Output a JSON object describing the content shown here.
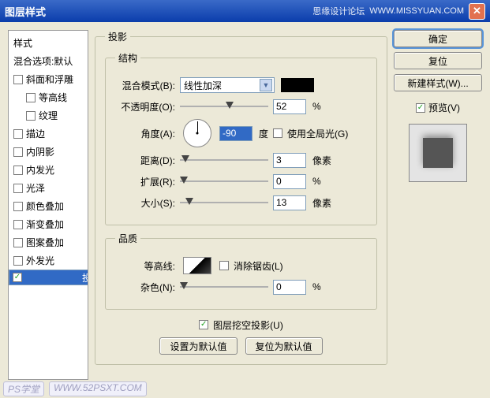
{
  "title": "图层样式",
  "watermark1": "思缘设计论坛",
  "watermark2": "WWW.MISSYUAN.COM",
  "sidebar": {
    "header": "样式",
    "blend": "混合选项:默认",
    "items": [
      {
        "label": "斜面和浮雕",
        "checked": false,
        "indent": false
      },
      {
        "label": "等高线",
        "checked": false,
        "indent": true
      },
      {
        "label": "纹理",
        "checked": false,
        "indent": true
      },
      {
        "label": "描边",
        "checked": false,
        "indent": false
      },
      {
        "label": "内阴影",
        "checked": false,
        "indent": false
      },
      {
        "label": "内发光",
        "checked": false,
        "indent": false
      },
      {
        "label": "光泽",
        "checked": false,
        "indent": false
      },
      {
        "label": "颜色叠加",
        "checked": false,
        "indent": false
      },
      {
        "label": "渐变叠加",
        "checked": false,
        "indent": false
      },
      {
        "label": "图案叠加",
        "checked": false,
        "indent": false
      },
      {
        "label": "外发光",
        "checked": false,
        "indent": false
      },
      {
        "label": "投影",
        "checked": true,
        "indent": false,
        "selected": true
      }
    ]
  },
  "panel_title": "投影",
  "structure": {
    "legend": "结构",
    "blend_label": "混合模式(B):",
    "blend_value": "线性加深",
    "opacity_label": "不透明度(O):",
    "opacity_value": "52",
    "percent": "%",
    "angle_label": "角度(A):",
    "angle_value": "-90",
    "degree": "度",
    "global_label": "使用全局光(G)",
    "distance_label": "距离(D):",
    "distance_value": "3",
    "px": "像素",
    "spread_label": "扩展(R):",
    "spread_value": "0",
    "size_label": "大小(S):",
    "size_value": "13"
  },
  "quality": {
    "legend": "品质",
    "contour_label": "等高线:",
    "antialias_label": "消除锯齿(L)",
    "noise_label": "杂色(N):",
    "noise_value": "0"
  },
  "knockout_label": "图层挖空投影(U)",
  "make_default": "设置为默认值",
  "reset_default": "复位为默认值",
  "buttons": {
    "ok": "确定",
    "cancel": "复位",
    "new_style": "新建样式(W)...",
    "preview": "预览(V)"
  },
  "footer": {
    "a": "PS学堂",
    "b": "WWW.52PSXT.COM"
  }
}
